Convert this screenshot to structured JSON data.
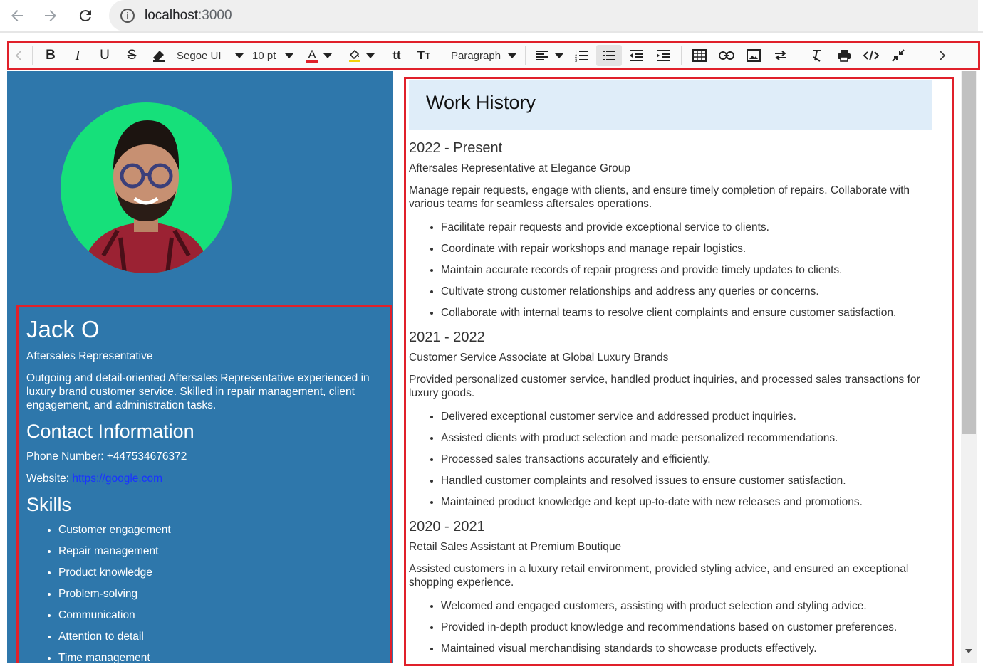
{
  "browser": {
    "host": "localhost",
    "port": ":3000",
    "icons": [
      "back-arrow-icon",
      "forward-arrow-icon",
      "reload-icon",
      "info-icon"
    ]
  },
  "toolbar": {
    "font_family": "Segoe UI",
    "font_size": "10 pt",
    "block_format": "Paragraph",
    "font_color": "#e0202a",
    "highlight_color": "#f2d20b",
    "icons": [
      "scroll-left-icon",
      "bold-icon",
      "italic-icon",
      "underline-icon",
      "strikethrough-icon",
      "eraser-icon",
      "font-color-icon",
      "highlight-icon",
      "lowercase-icon",
      "uppercase-icon",
      "align-icon",
      "ordered-list-icon",
      "unordered-list-icon",
      "outdent-icon",
      "indent-icon",
      "table-icon",
      "link-icon",
      "image-icon",
      "swap-icon",
      "clear-format-icon",
      "print-icon",
      "source-code-icon",
      "minimize-icon",
      "scroll-right-icon"
    ]
  },
  "sidebar": {
    "name": "Jack O",
    "title": "Aftersales Representative",
    "summary": "Outgoing and detail-oriented Aftersales Representative experienced in luxury brand customer service. Skilled in repair management, client engagement, and administration tasks.",
    "contact_heading": "Contact Information",
    "phone": "Phone Number: +447534676372",
    "website_label": "Website:",
    "website_url": "https://google.com",
    "skills_heading": "Skills",
    "skills": [
      "Customer engagement",
      "Repair management",
      "Product knowledge",
      "Problem-solving",
      "Communication",
      "Attention to detail",
      "Time management"
    ],
    "avatar_bg": "#16e07a",
    "panel_bg": "#2e77ab"
  },
  "work": {
    "heading": "Work History",
    "jobs": [
      {
        "years": "2022 - Present",
        "role": "Aftersales Representative at Elegance Group",
        "desc": "Manage repair requests, engage with clients, and ensure timely completion of repairs. Collaborate with various teams for seamless aftersales operations.",
        "bullets": [
          "Facilitate repair requests and provide exceptional service to clients.",
          "Coordinate with repair workshops and manage repair logistics.",
          "Maintain accurate records of repair progress and provide timely updates to clients.",
          "Cultivate strong customer relationships and address any queries or concerns.",
          "Collaborate with internal teams to resolve client complaints and ensure customer satisfaction."
        ]
      },
      {
        "years": "2021 - 2022",
        "role": "Customer Service Associate at Global Luxury Brands",
        "desc": "Provided personalized customer service, handled product inquiries, and processed sales transactions for luxury goods.",
        "bullets": [
          "Delivered exceptional customer service and addressed product inquiries.",
          "Assisted clients with product selection and made personalized recommendations.",
          "Processed sales transactions accurately and efficiently.",
          "Handled customer complaints and resolved issues to ensure customer satisfaction.",
          "Maintained product knowledge and kept up-to-date with new releases and promotions."
        ]
      },
      {
        "years": "2020 - 2021",
        "role": "Retail Sales Assistant at Premium Boutique",
        "desc": "Assisted customers in a luxury retail environment, provided styling advice, and ensured an exceptional shopping experience.",
        "bullets": [
          "Welcomed and engaged customers, assisting with product selection and styling advice.",
          "Provided in-depth product knowledge and recommendations based on customer preferences.",
          "Maintained visual merchandising standards to showcase products effectively."
        ]
      }
    ]
  }
}
